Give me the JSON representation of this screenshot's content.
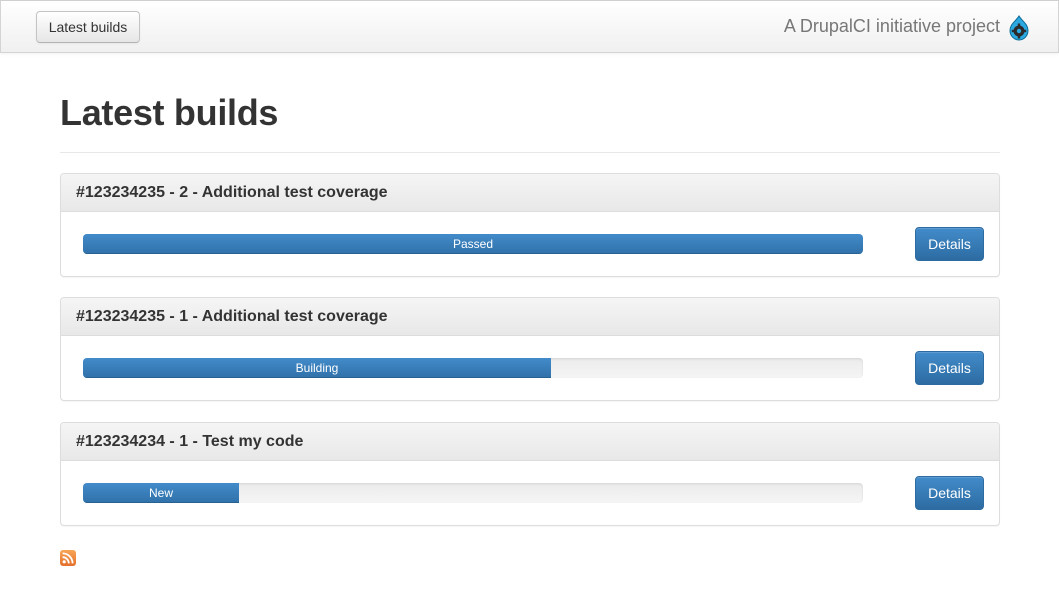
{
  "navbar": {
    "button_label": "Latest builds",
    "brand_text": "A DrupalCI initiative project",
    "brand_icon": "drupal-drop-icon"
  },
  "page": {
    "title": "Latest builds"
  },
  "builds": [
    {
      "title": "#123234235 - 2 - Additional test coverage",
      "status": "Passed",
      "progress_percent": 100,
      "details_label": "Details"
    },
    {
      "title": "#123234235 - 1 - Additional test coverage",
      "status": "Building",
      "progress_percent": 60,
      "details_label": "Details"
    },
    {
      "title": "#123234234 - 1 - Test my code",
      "status": "New",
      "progress_percent": 20,
      "details_label": "Details"
    }
  ],
  "footer": {
    "feed_icon": "rss-icon"
  },
  "colors": {
    "progress_bar": "#428bca",
    "button_primary": "#3276b1",
    "rss": "#f0883b"
  }
}
